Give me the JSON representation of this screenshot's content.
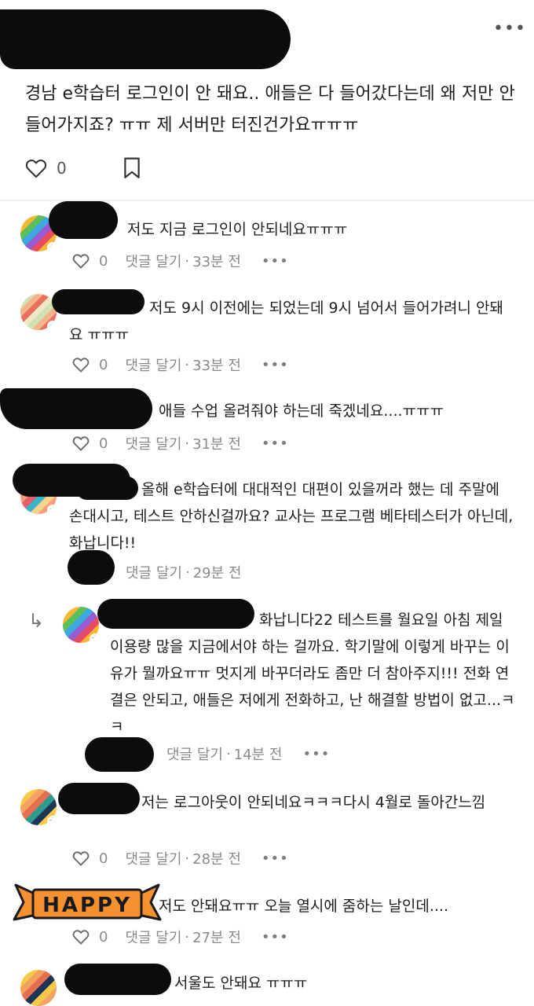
{
  "post": {
    "text": "경남 e학습터 로그인이 안 돼요.. 애들은 다 들어갔다는데 왜 저만 안 들어가지죠? ㅠㅠ 제 서버만 터진건가요ㅠㅠㅠ",
    "likes": "0",
    "more": "•••"
  },
  "comments": [
    {
      "text": "저도 지금 로그인이 안되네요ㅠㅠㅠ",
      "likes": "0",
      "reply_label": "댓글 달기",
      "sep": "·",
      "time": "33분 전",
      "more": "•••"
    },
    {
      "text": "저도 9시 이전에는 되었는데 9시 넘어서 들어가려니 안돼요 ㅠㅠㅠ",
      "likes": "0",
      "reply_label": "댓글 달기",
      "sep": "·",
      "time": "33분 전",
      "more": "•••"
    },
    {
      "text": "애들 수업 올려줘야 하는데 죽겠네요....ㅠㅠㅠ",
      "likes": "0",
      "reply_label": "댓글 달기",
      "sep": "·",
      "time": "31분 전",
      "more": "•••"
    },
    {
      "text": "올해 e학습터에 대대적인 대편이 있을꺼라 했는 데 주말에 손대시고, 테스트 안하신걸까요? 교사는 프로그램 베타테스터가 아닌데, 화납니다!!",
      "reply_label": "댓글 달기",
      "sep": "·",
      "time": "29분 전"
    },
    {
      "text": "화납니다22 테스트를 월요일 아침 제일 이용량 많을 지금에서야 하는 걸까요. 학기말에 이렇게 바꾸는 이유가 뭘까요ㅠㅠ 멋지게 바꾸더라도 좀만 더 참아주지!!! 전화 연결은 안되고, 애들은 저에게 전화하고, 난 해결할 방법이 없고...ㅋㅋ",
      "reply_label": "댓글 달기",
      "sep": "·",
      "time": "14분 전",
      "more": "•••"
    },
    {
      "text": "저는 로그아웃이 안되네요ㅋㅋㅋ다시 4월로 돌아간느낌",
      "likes": "0",
      "reply_label": "댓글 달기",
      "sep": "·",
      "time": "28분 전",
      "more": "•••"
    },
    {
      "text": "저도 안돼요ㅠㅠ 오늘 열시에 줌하는 날인데....",
      "likes": "0",
      "reply_label": "댓글 달기",
      "sep": "·",
      "time": "27분 전",
      "more": "•••"
    },
    {
      "text": "서울도 안돼요 ㅠㅠㅠ"
    }
  ],
  "sticker": {
    "label": "HAPPY"
  },
  "colors": {
    "text": "#1d1d1d",
    "meta": "#8a8a8a",
    "redaction": "#0c0c0c",
    "badge_red": "#e03b3b",
    "sticker": "#f5922f"
  }
}
